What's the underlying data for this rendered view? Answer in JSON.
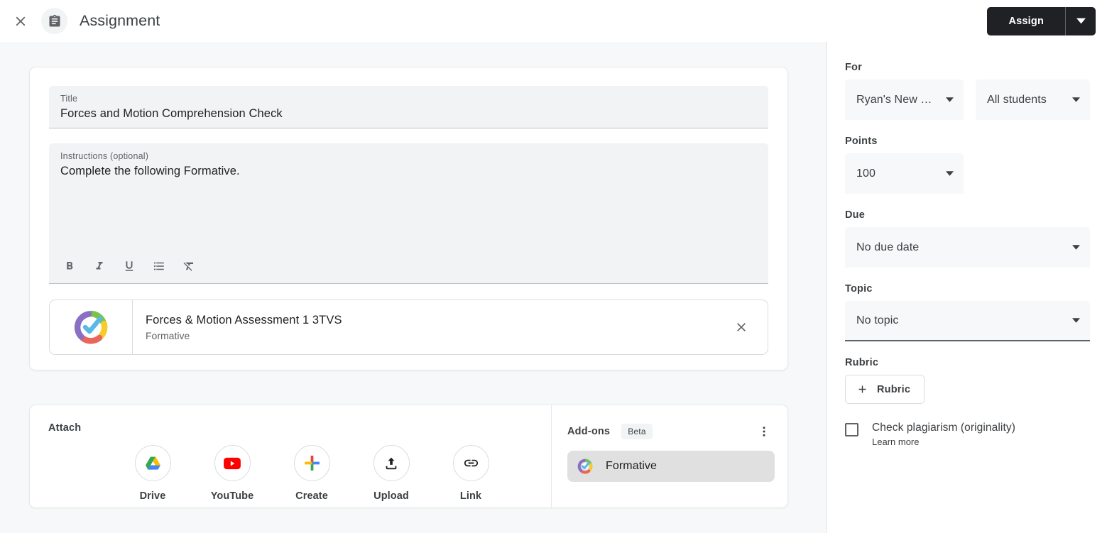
{
  "header": {
    "close_icon": "close-icon",
    "assignment_icon": "assignment-clipboard-icon",
    "title": "Assignment",
    "assign_label": "Assign",
    "assign_caret_icon": "chevron-down-icon"
  },
  "main": {
    "title_field": {
      "label": "Title",
      "value": "Forces and Motion Comprehension Check"
    },
    "instructions_field": {
      "label": "Instructions (optional)",
      "value": "Complete the following Formative."
    },
    "format_toolbar": [
      {
        "name": "bold-icon",
        "glyph": "B"
      },
      {
        "name": "italic-icon",
        "glyph": "I"
      },
      {
        "name": "underline-icon",
        "glyph": "U"
      },
      {
        "name": "bulleted-list-icon",
        "glyph": "list"
      },
      {
        "name": "clear-formatting-icon",
        "glyph": "clear"
      }
    ],
    "attachment": {
      "icon": "formative-logo-icon",
      "title": "Forces & Motion Assessment 1 3TVS",
      "subtitle": "Formative",
      "remove_icon": "close-icon"
    },
    "attach_panel": {
      "title": "Attach",
      "options": [
        {
          "name": "drive",
          "label": "Drive",
          "icon": "google-drive-icon"
        },
        {
          "name": "youtube",
          "label": "YouTube",
          "icon": "youtube-icon"
        },
        {
          "name": "create",
          "label": "Create",
          "icon": "create-plus-icon"
        },
        {
          "name": "upload",
          "label": "Upload",
          "icon": "upload-icon"
        },
        {
          "name": "link",
          "label": "Link",
          "icon": "link-icon"
        }
      ]
    },
    "addons_panel": {
      "title": "Add-ons",
      "badge": "Beta",
      "menu_icon": "more-vert-icon",
      "items": [
        {
          "label": "Formative",
          "icon": "formative-logo-icon",
          "selected": true
        }
      ]
    }
  },
  "sidebar": {
    "for_label": "For",
    "class_value": "Ryan's New …",
    "students_value": "All students",
    "points_label": "Points",
    "points_value": "100",
    "due_label": "Due",
    "due_value": "No due date",
    "topic_label": "Topic",
    "topic_value": "No topic",
    "rubric_label": "Rubric",
    "rubric_button": "Rubric",
    "rubric_plus_icon": "plus-icon",
    "plagiarism_label": "Check plagiarism (originality)",
    "plagiarism_learn_more": "Learn more",
    "plagiarism_checked": false
  },
  "colors": {
    "assign_button_bg": "#202124",
    "page_bg": "#f6f8f9",
    "field_bg": "#f1f3f4",
    "addon_selected_bg": "#e0e0e0"
  }
}
